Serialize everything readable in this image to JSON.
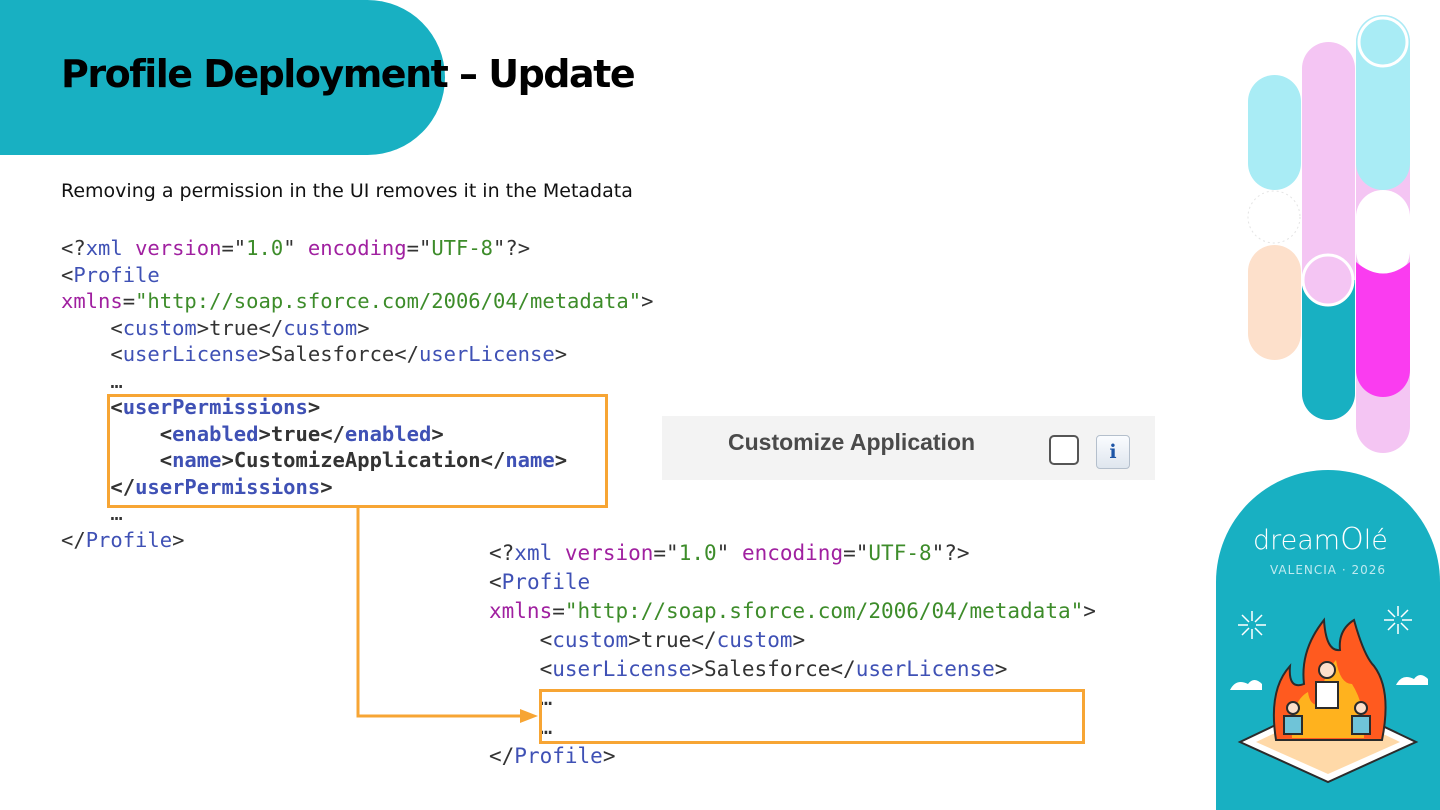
{
  "slide": {
    "title": "Profile Deployment – Update",
    "subtitle": "Removing a permission in the UI removes it in the Metadata"
  },
  "code_before": {
    "xml_decl_version": "1.0",
    "xml_decl_encoding": "UTF-8",
    "root_tag": "Profile",
    "xmlns_attr": "xmlns",
    "xmlns_value": "http://soap.sforce.com/2006/04/metadata",
    "custom_tag": "custom",
    "custom_value": "true",
    "user_license_tag": "userLicense",
    "user_license_value": "Salesforce",
    "ellipsis": "…",
    "user_permissions_tag": "userPermissions",
    "enabled_tag": "enabled",
    "enabled_value": "true",
    "name_tag": "name",
    "name_value": "CustomizeApplication"
  },
  "code_after": {
    "xml_decl_version": "1.0",
    "xml_decl_encoding": "UTF-8",
    "root_tag": "Profile",
    "xmlns_attr": "xmlns",
    "xmlns_value": "http://soap.sforce.com/2006/04/metadata",
    "custom_tag": "custom",
    "custom_value": "true",
    "user_license_tag": "userLicense",
    "user_license_value": "Salesforce",
    "ellipsis": "…"
  },
  "permission_ui": {
    "label": "Customize Application",
    "checked": false,
    "info_icon": "info-icon",
    "info_glyph": "i"
  },
  "event": {
    "logo": "dreamOlé",
    "logo_prefix": "dream",
    "logo_suffix": "lé",
    "location_year": "VALENCIA · 2026"
  },
  "colors": {
    "teal": "#18b0c2",
    "highlight_orange": "#f7a534",
    "xml_tag": "#3f51b5",
    "xml_attr": "#a020a0",
    "xml_string": "#3d8c2a"
  }
}
